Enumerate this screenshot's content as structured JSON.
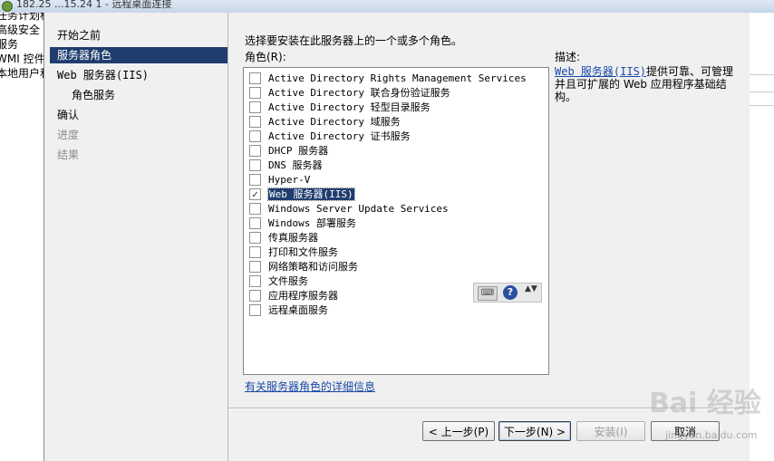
{
  "window": {
    "title": "182.25 ...15.24 1 - 远程桌面连接"
  },
  "background_pane": {
    "lines": [
      "任务计划程",
      "高级安全",
      "服务",
      "WMI 控件",
      "本地用户和"
    ]
  },
  "nav": {
    "items": [
      {
        "label": "开始之前",
        "state": "normal"
      },
      {
        "label": "服务器角色",
        "state": "selected"
      },
      {
        "label": "Web 服务器(IIS)",
        "state": "normal"
      },
      {
        "label": "角色服务",
        "state": "normal"
      },
      {
        "label": "确认",
        "state": "normal"
      },
      {
        "label": "进度",
        "state": "disabled"
      },
      {
        "label": "结果",
        "state": "disabled"
      }
    ]
  },
  "content": {
    "instruction": "选择要安装在此服务器上的一个或多个角色。",
    "roles_label": "角色(R):",
    "roles": [
      {
        "label": "Active Directory Rights Management Services",
        "checked": false
      },
      {
        "label": "Active Directory 联合身份验证服务",
        "checked": false
      },
      {
        "label": "Active Directory 轻型目录服务",
        "checked": false
      },
      {
        "label": "Active Directory 域服务",
        "checked": false
      },
      {
        "label": "Active Directory 证书服务",
        "checked": false
      },
      {
        "label": "DHCP 服务器",
        "checked": false
      },
      {
        "label": "DNS 服务器",
        "checked": false
      },
      {
        "label": "Hyper-V",
        "checked": false
      },
      {
        "label": "Web 服务器(IIS)",
        "checked": true,
        "selected": true
      },
      {
        "label": "Windows Server Update Services",
        "checked": false
      },
      {
        "label": "Windows 部署服务",
        "checked": false
      },
      {
        "label": "传真服务器",
        "checked": false
      },
      {
        "label": "打印和文件服务",
        "checked": false
      },
      {
        "label": "网络策略和访问服务",
        "checked": false
      },
      {
        "label": "文件服务",
        "checked": false
      },
      {
        "label": "应用程序服务器",
        "checked": false
      },
      {
        "label": "远程桌面服务",
        "checked": false
      }
    ],
    "check_mark": "✓",
    "description": {
      "title": "描述:",
      "link": "Web 服务器(IIS)",
      "text": "提供可靠、可管理并且可扩展的 Web 应用程序基础结构。"
    },
    "more_info_link": "有关服务器角色的详细信息",
    "ime_toolbar": {
      "keyboard_glyph": "⌨",
      "help_glyph": "?",
      "spinner_glyph": "▲▼"
    }
  },
  "buttons": {
    "back": "< 上一步(P)",
    "next": "下一步(N) >",
    "install": "安装(I)",
    "cancel": "取消"
  },
  "watermark": {
    "text": "Bai 经验",
    "url": "jingyan.baidu.com"
  }
}
